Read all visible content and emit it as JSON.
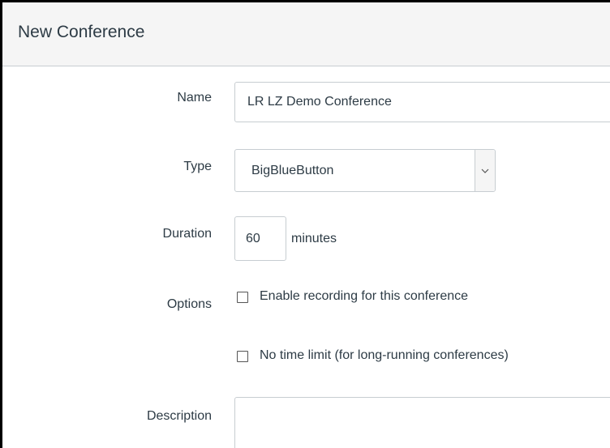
{
  "dialog": {
    "title": "New Conference"
  },
  "form": {
    "name": {
      "label": "Name",
      "value": "LR LZ Demo Conference"
    },
    "type": {
      "label": "Type",
      "selected": "BigBlueButton"
    },
    "duration": {
      "label": "Duration",
      "value": "60",
      "unit": "minutes"
    },
    "options": {
      "label": "Options",
      "enable_recording": {
        "label": "Enable recording for this conference",
        "checked": false
      },
      "no_time_limit": {
        "label": "No time limit (for long-running conferences)",
        "checked": false
      }
    },
    "description": {
      "label": "Description",
      "value": ""
    }
  },
  "colors": {
    "text": "#2d3b45",
    "border": "#c7cdd1",
    "header_bg": "#f5f5f5"
  },
  "icons": {
    "select_arrow": "chevron-down-icon"
  }
}
